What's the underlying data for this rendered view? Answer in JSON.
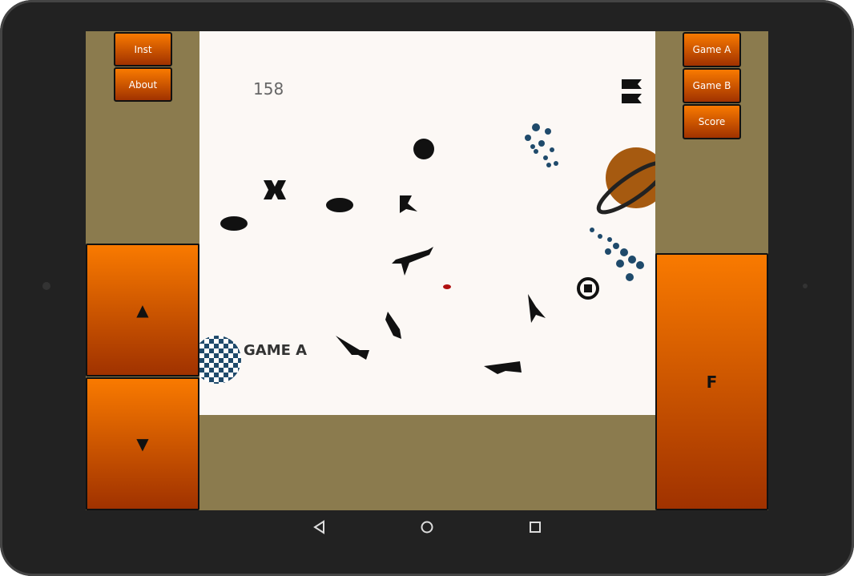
{
  "menu_left": {
    "inst": "Inst",
    "about": "About"
  },
  "menu_right": {
    "game_a": "Game A",
    "game_b": "Game B",
    "score": "Score"
  },
  "controls": {
    "up": "▲",
    "down": "▼",
    "fire": "F"
  },
  "game": {
    "score": "158",
    "mode_label": "GAME A"
  },
  "colors": {
    "panel": "#8b7b4e",
    "playfield": "#fcf8f5",
    "button_top": "#f97a00",
    "button_bottom": "#a03200",
    "planet": "#a65a10",
    "dots": "#1f4a6b"
  }
}
